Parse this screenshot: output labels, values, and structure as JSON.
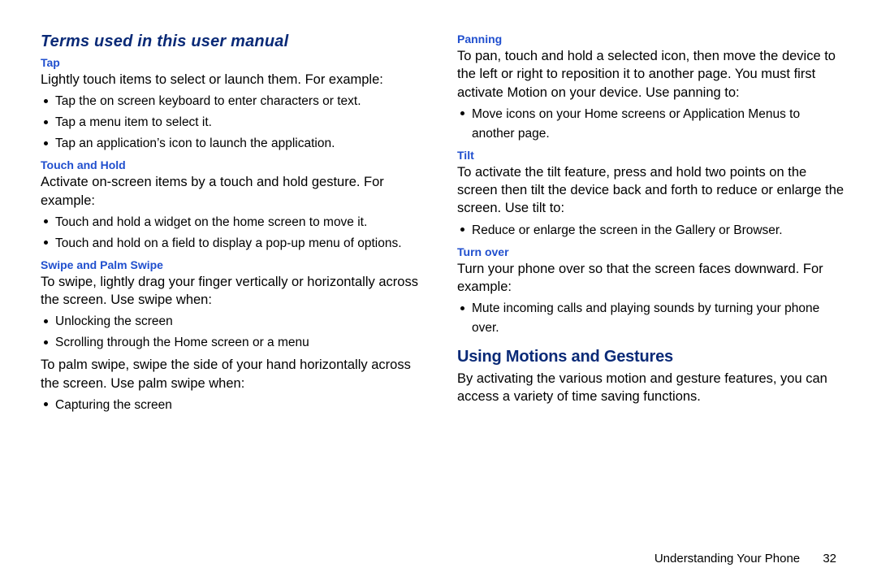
{
  "left": {
    "heading": "Terms used in this user manual",
    "tap": {
      "title": "Tap",
      "intro": "Lightly touch items to select or launch them. For example:",
      "items": [
        "Tap the on screen keyboard to enter characters or text.",
        "Tap a menu item to select it.",
        "Tap an application’s icon to launch the application."
      ]
    },
    "touchHold": {
      "title": "Touch and Hold",
      "intro": "Activate on-screen items by a touch and hold gesture. For example:",
      "items": [
        "Touch and hold a widget on the home screen to move it.",
        "Touch and hold on a field to display a pop-up menu of options."
      ]
    },
    "swipe": {
      "title": "Swipe and Palm Swipe",
      "intro": "To swipe, lightly drag your finger vertically or horizontally across the screen. Use swipe when:",
      "items": [
        "Unlocking the screen",
        "Scrolling through the Home screen or a menu"
      ],
      "palmIntro": "To palm swipe, swipe the side of your hand horizontally across the screen. Use palm swipe when:",
      "palmItems": [
        "Capturing the screen"
      ]
    }
  },
  "right": {
    "panning": {
      "title": "Panning",
      "intro": "To pan, touch and hold a selected icon, then move the device to the left or right to reposition it to another page. You must first activate Motion on your device. Use panning to:",
      "items": [
        "Move icons on your Home screens or Application Menus to another page."
      ]
    },
    "tilt": {
      "title": "Tilt",
      "intro": "To activate the tilt feature, press and hold two points on the screen then tilt the device back and forth to reduce or enlarge the screen. Use tilt to:",
      "items": [
        "Reduce or enlarge the screen in the Gallery or Browser."
      ]
    },
    "turnover": {
      "title": "Turn over",
      "intro": "Turn your phone over so that the screen faces downward. For example:",
      "items": [
        "Mute incoming calls and playing sounds by turning your phone over."
      ]
    },
    "motions": {
      "title": "Using Motions and Gestures",
      "body": "By activating the various motion and gesture features, you can access a variety of time saving functions."
    }
  },
  "footer": {
    "chapter": "Understanding Your Phone",
    "page": "32"
  }
}
